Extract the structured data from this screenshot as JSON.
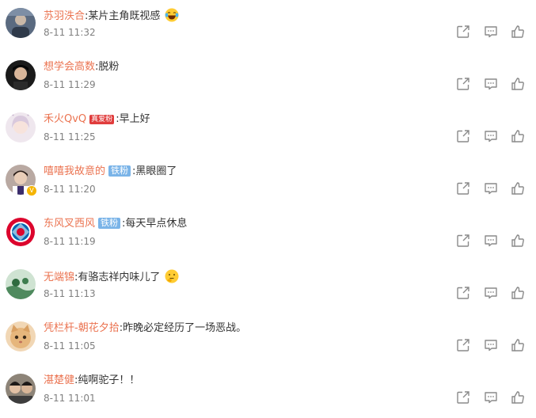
{
  "comments": [
    {
      "user": "苏羽泆合",
      "separator": ":",
      "text": "某片主角既视感",
      "time": "8-11 11:32",
      "emoji": "laugh-tears-emoji"
    },
    {
      "user": "想学会高数",
      "separator": ":",
      "text": "脱粉",
      "time": "8-11 11:29"
    },
    {
      "user": "禾火QvQ",
      "badge": "真爱粉",
      "separator": ":",
      "text": "早上好",
      "time": "8-11 11:25"
    },
    {
      "user": "嘻嘻我故意的",
      "badge": "铁粉",
      "separator": ":",
      "text": "黑眼圈了",
      "time": "8-11 11:20"
    },
    {
      "user": "东风叉西风",
      "badge": "铁粉",
      "separator": ":",
      "text": "每天早点休息",
      "time": "8-11 11:19"
    },
    {
      "user": "无端锦",
      "separator": ":",
      "text": "有骆志祥内味儿了",
      "time": "8-11 11:13",
      "emoji": "thinking-emoji"
    },
    {
      "user": "凭栏杆-朝花夕拾",
      "separator": ":",
      "text": "昨晚必定经历了一场恶战。",
      "time": "8-11 11:05"
    },
    {
      "user": "湛楚健",
      "separator": ":",
      "text": "纯啊驼子！！",
      "time": "8-11 11:01"
    }
  ],
  "actions": {
    "share_icon": "share-icon",
    "reply_icon": "comment-icon",
    "like_icon": "thumbs-up-icon"
  },
  "colors": {
    "username": "#eb7350",
    "text": "#333333",
    "time": "#808080",
    "icon": "#8a8a8a",
    "iron_badge": "#7ab4e8",
    "true_fan_badge": "#e03c3c"
  }
}
